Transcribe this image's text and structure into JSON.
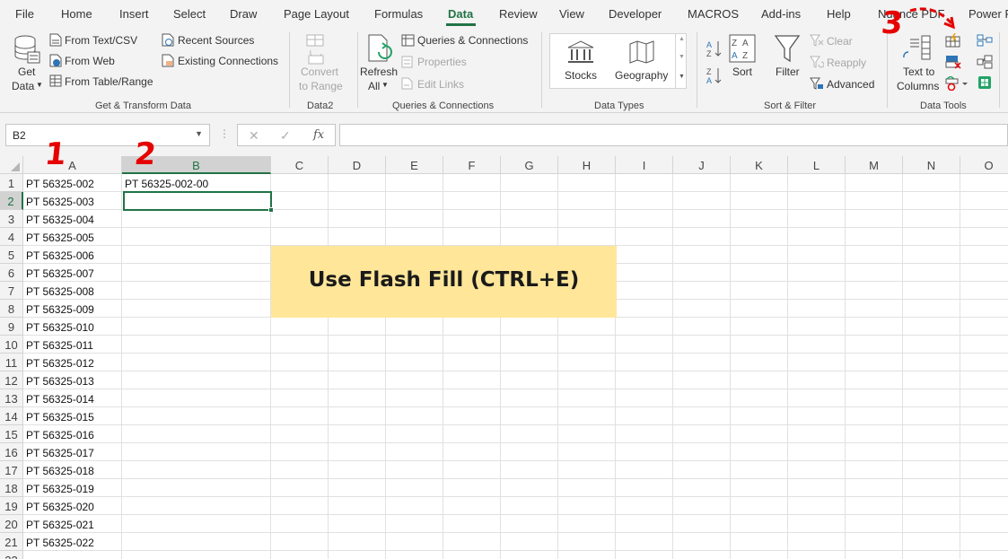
{
  "tabs": [
    {
      "label": "File",
      "active": false
    },
    {
      "label": "Home",
      "active": false
    },
    {
      "label": "Insert",
      "active": false
    },
    {
      "label": "Select",
      "active": false
    },
    {
      "label": "Draw",
      "active": false
    },
    {
      "label": "Page Layout",
      "active": false
    },
    {
      "label": "Formulas",
      "active": false
    },
    {
      "label": "Data",
      "active": true
    },
    {
      "label": "Review",
      "active": false
    },
    {
      "label": "View",
      "active": false
    },
    {
      "label": "Developer",
      "active": false
    },
    {
      "label": "MACROS",
      "active": false
    },
    {
      "label": "Add-ins",
      "active": false
    },
    {
      "label": "Help",
      "active": false
    },
    {
      "label": "Nuance PDF",
      "active": false
    },
    {
      "label": "Power P",
      "active": false
    }
  ],
  "ribbon": {
    "get_transform": {
      "get_data_line1": "Get",
      "get_data_line2": "Data",
      "from_text_csv": "From Text/CSV",
      "from_web": "From Web",
      "from_table_range": "From Table/Range",
      "recent_sources": "Recent Sources",
      "existing_connections": "Existing Connections",
      "group_label": "Get & Transform Data"
    },
    "data2": {
      "convert_line1": "Convert",
      "convert_line2": "to Range",
      "group_label": "Data2"
    },
    "queries": {
      "refresh_line1": "Refresh",
      "refresh_line2": "All",
      "queries_connections": "Queries & Connections",
      "properties": "Properties",
      "edit_links": "Edit Links",
      "group_label": "Queries & Connections"
    },
    "data_types": {
      "stocks": "Stocks",
      "geography": "Geography",
      "group_label": "Data Types"
    },
    "sort_filter": {
      "sort": "Sort",
      "filter": "Filter",
      "clear": "Clear",
      "reapply": "Reapply",
      "advanced": "Advanced",
      "group_label": "Sort & Filter"
    },
    "data_tools": {
      "text_to_line1": "Text to",
      "text_to_line2": "Columns",
      "group_label": "Data Tools"
    }
  },
  "formula_bar": {
    "name_box": "B2",
    "cancel_symbol": "✕",
    "enter_symbol": "✓",
    "fx_symbol": "fx",
    "formula_value": ""
  },
  "columns": [
    "A",
    "B",
    "C",
    "D",
    "E",
    "F",
    "G",
    "H",
    "I",
    "J",
    "K",
    "L",
    "M",
    "N",
    "O"
  ],
  "selected_column": "B",
  "rows": [
    {
      "num": "1",
      "a": "PT 56325-002",
      "b": "PT 56325-002-00"
    },
    {
      "num": "2",
      "a": "PT 56325-003",
      "b": ""
    },
    {
      "num": "3",
      "a": "PT 56325-004",
      "b": ""
    },
    {
      "num": "4",
      "a": "PT 56325-005",
      "b": ""
    },
    {
      "num": "5",
      "a": "PT 56325-006",
      "b": ""
    },
    {
      "num": "6",
      "a": "PT 56325-007",
      "b": ""
    },
    {
      "num": "7",
      "a": "PT 56325-008",
      "b": ""
    },
    {
      "num": "8",
      "a": "PT 56325-009",
      "b": ""
    },
    {
      "num": "9",
      "a": "PT 56325-010",
      "b": ""
    },
    {
      "num": "10",
      "a": "PT 56325-011",
      "b": ""
    },
    {
      "num": "11",
      "a": "PT 56325-012",
      "b": ""
    },
    {
      "num": "12",
      "a": "PT 56325-013",
      "b": ""
    },
    {
      "num": "13",
      "a": "PT 56325-014",
      "b": ""
    },
    {
      "num": "14",
      "a": "PT 56325-015",
      "b": ""
    },
    {
      "num": "15",
      "a": "PT 56325-016",
      "b": ""
    },
    {
      "num": "16",
      "a": "PT 56325-017",
      "b": ""
    },
    {
      "num": "17",
      "a": "PT 56325-018",
      "b": ""
    },
    {
      "num": "18",
      "a": "PT 56325-019",
      "b": ""
    },
    {
      "num": "19",
      "a": "PT 56325-020",
      "b": ""
    },
    {
      "num": "20",
      "a": "PT 56325-021",
      "b": ""
    },
    {
      "num": "21",
      "a": "PT 56325-022",
      "b": ""
    },
    {
      "num": "22",
      "a": "",
      "b": ""
    }
  ],
  "selected_row": "2",
  "callout": {
    "text": "Use Flash Fill (CTRL+E)",
    "bg": "#ffe699"
  },
  "annotations": [
    "1",
    "2",
    "3"
  ],
  "colors": {
    "accent": "#217346",
    "annotation": "#e60000"
  },
  "icons": [
    "database-icon",
    "text-file-icon",
    "web-icon",
    "table-icon",
    "recent-sources-icon",
    "connections-icon",
    "convert-range-icon",
    "refresh-icon",
    "queries-icon",
    "properties-icon",
    "edit-links-icon",
    "stocks-icon",
    "geography-icon",
    "sort-az-icon",
    "sort-za-icon",
    "sort-icon",
    "filter-icon",
    "clear-filter-icon",
    "reapply-icon",
    "advanced-filter-icon",
    "text-to-columns-icon",
    "flash-fill-icon",
    "remove-duplicates-icon",
    "data-validation-icon",
    "consolidate-icon",
    "relationships-icon",
    "manage-data-model-icon"
  ]
}
